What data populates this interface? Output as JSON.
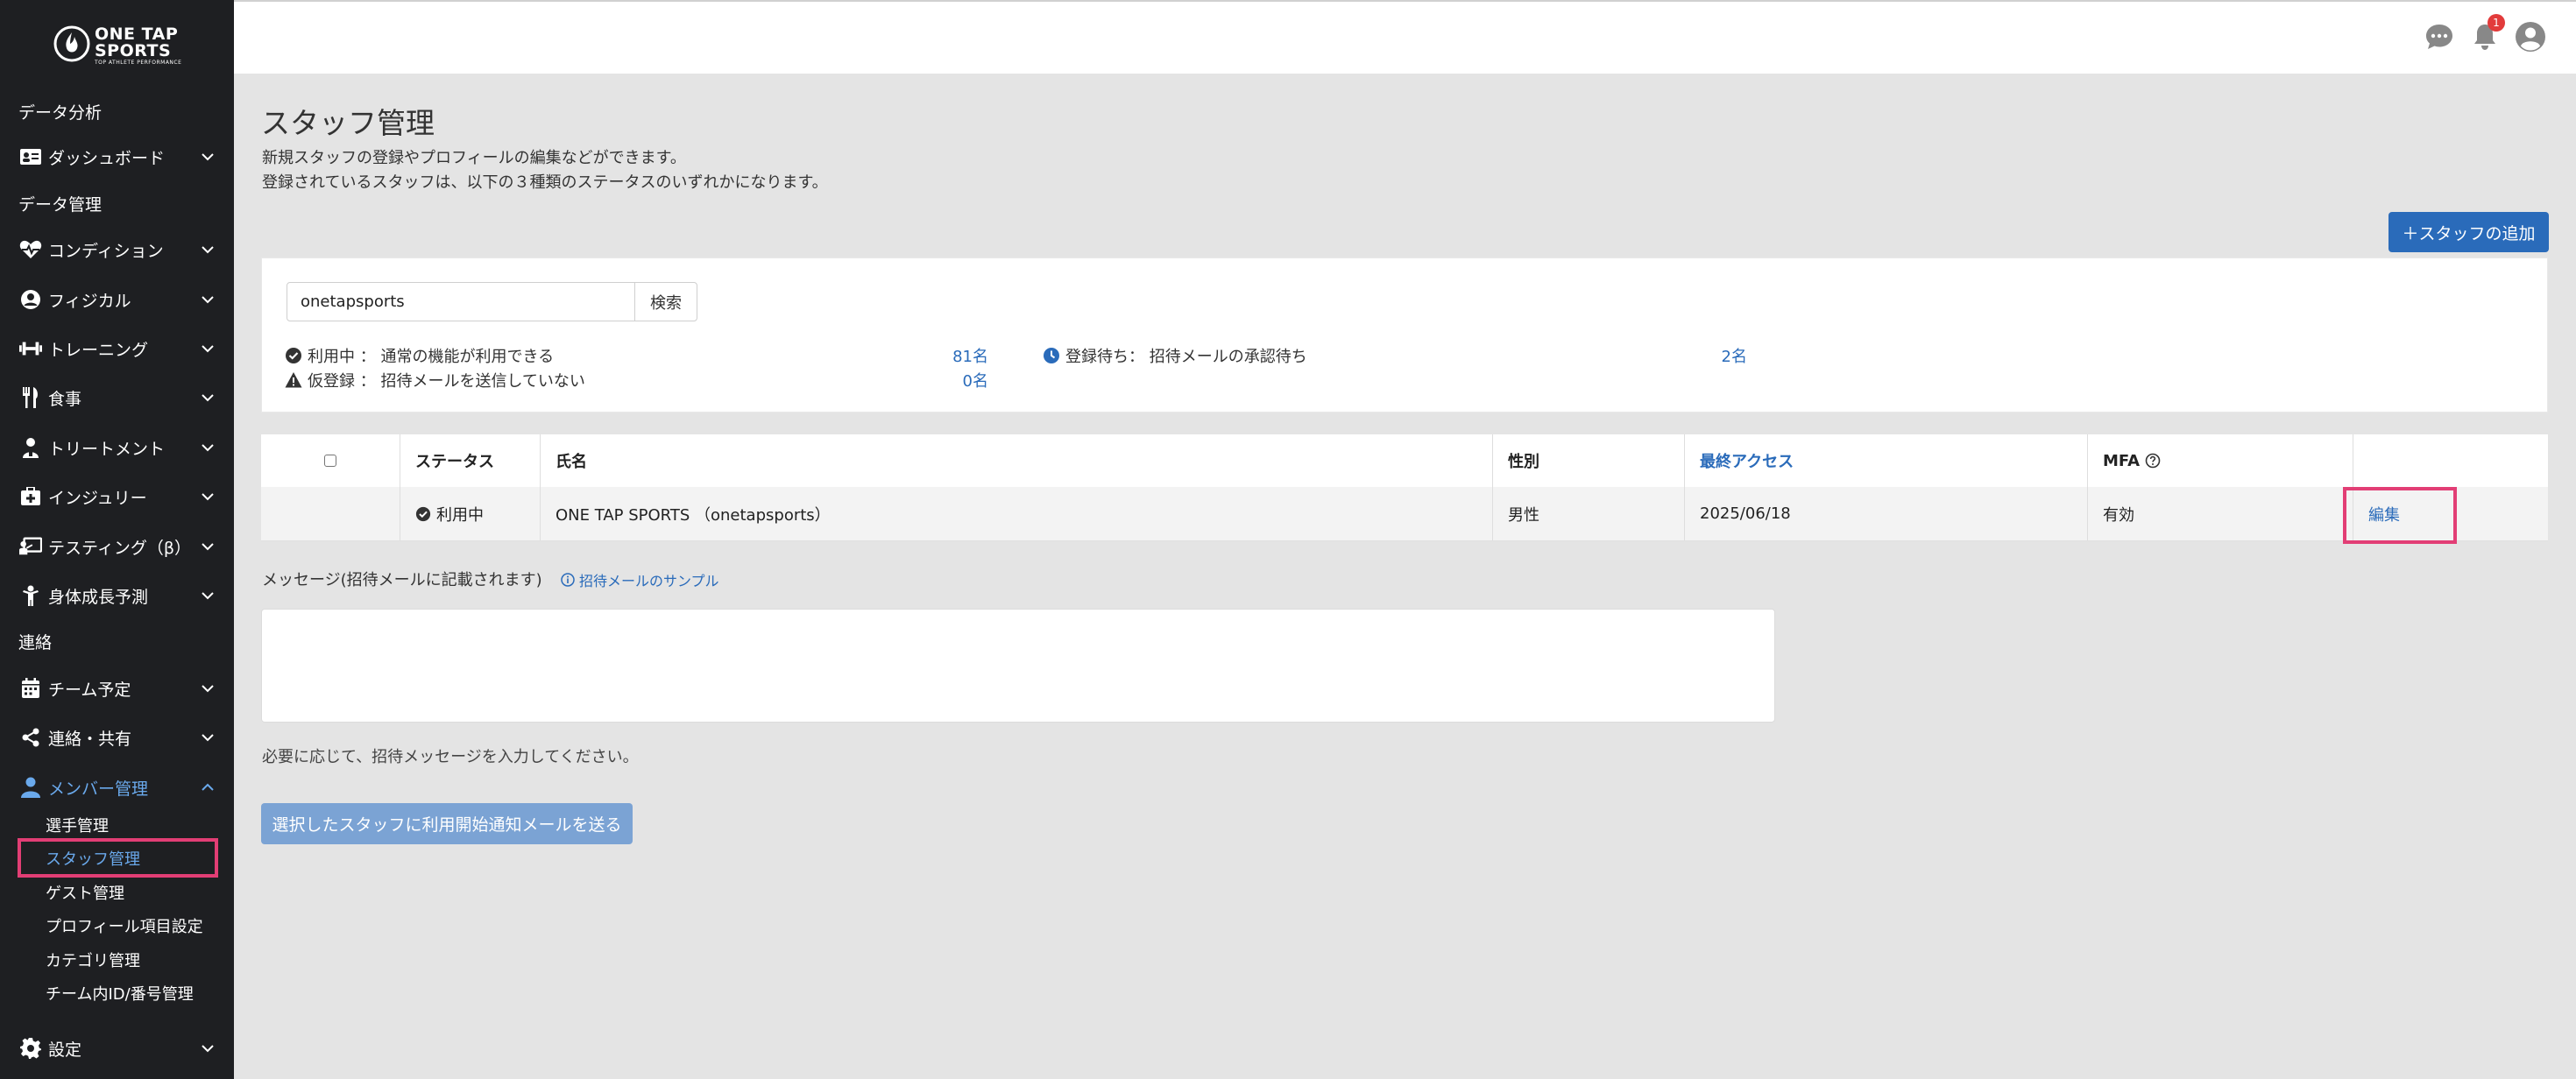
{
  "brand": {
    "name_line1": "ONE TAP",
    "name_line2": "SPORTS",
    "tagline": "TOP ATHLETE PERFORMANCE"
  },
  "sidebar": {
    "sections": [
      "データ分析",
      "データ管理",
      "連絡"
    ],
    "items": [
      {
        "label": "ダッシュボード",
        "icon": "id-card-icon"
      },
      {
        "label": "コンディション",
        "icon": "heartbeat-icon"
      },
      {
        "label": "フィジカル",
        "icon": "user-circle-icon"
      },
      {
        "label": "トレーニング",
        "icon": "dumbbell-icon"
      },
      {
        "label": "食事",
        "icon": "utensils-icon"
      },
      {
        "label": "トリートメント",
        "icon": "treatment-icon"
      },
      {
        "label": "インジュリー",
        "icon": "first-aid-icon"
      },
      {
        "label": "テスティング（β）",
        "icon": "chalkboard-icon"
      },
      {
        "label": "身体成長予測",
        "icon": "child-icon"
      },
      {
        "label": "チーム予定",
        "icon": "calendar-icon"
      },
      {
        "label": "連絡・共有",
        "icon": "share-icon"
      },
      {
        "label": "メンバー管理",
        "icon": "user-icon"
      },
      {
        "label": "設定",
        "icon": "gear-icon"
      }
    ],
    "member_sub": [
      "選手管理",
      "スタッフ管理",
      "ゲスト管理",
      "プロフィール項目設定",
      "カテゴリ管理",
      "チーム内ID/番号管理"
    ]
  },
  "topbar": {
    "notification_count": "1"
  },
  "page": {
    "title": "スタッフ管理",
    "desc1": "新規スタッフの登録やプロフィールの編集などができます。",
    "desc2": "登録されているスタッフは、以下の３種類のステータスのいずれかになります。",
    "add_button": "＋スタッフの追加"
  },
  "search": {
    "value": "onetapsports",
    "button": "検索"
  },
  "stats": {
    "active_label": "利用中 ： 通常の機能が利用できる",
    "active_count": "81名",
    "pending_label": "登録待ち： 招待メールの承認待ち",
    "pending_count": "2名",
    "provisional_label": "仮登録 ： 招待メールを送信していない",
    "provisional_count": "0名"
  },
  "table": {
    "headers": {
      "status": "ステータス",
      "name": "氏名",
      "gender": "性別",
      "last_access": "最終アクセス",
      "mfa": "MFA"
    },
    "rows": [
      {
        "status": "利用中",
        "name": "ONE TAP SPORTS （onetapsports）",
        "gender": "男性",
        "last_access": "2025/06/18",
        "mfa": "有効",
        "action": "編集"
      }
    ]
  },
  "message": {
    "label": "メッセージ(招待メールに記載されます)",
    "sample_link": "招待メールのサンプル",
    "hint": "必要に応じて、招待メッセージを入力してください。",
    "send_button": "選択したスタッフに利用開始通知メールを送る"
  },
  "colors": {
    "sidebar_bg": "#1e1f22",
    "accent": "#2a6bba",
    "highlight": "#e23e75",
    "active_nav": "#6aa9ec"
  }
}
